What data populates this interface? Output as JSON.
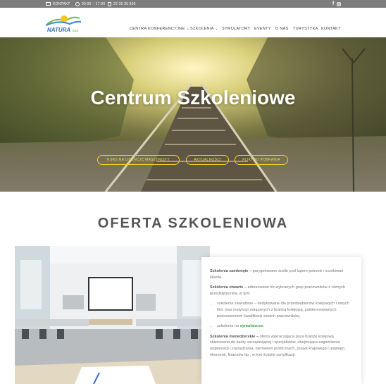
{
  "topbar": {
    "contact_label": "KONTAKT",
    "hours": "09:00 – 17:00",
    "phone": "22 39 35 600",
    "social": [
      "f",
      "ig"
    ]
  },
  "header": {
    "logo_text": "NATURA",
    "logo_sub": "tour",
    "nav": [
      "CENTRA KONFERENCYJNE ⌄",
      "SZKOLENIA ⌄",
      "SYMULATORY",
      "EVENTY",
      "O NAS",
      "TURYSTYKA",
      "KONTAKT"
    ]
  },
  "hero": {
    "title": "Centrum Szkoleniowe",
    "buttons": [
      "KURS NA LICENCJĘ MASZYNISTY",
      "AKTUALNOŚCI",
      "PLIKI DO POBRANIA"
    ]
  },
  "offer": {
    "title": "OFERTA SZKOLENIOWA",
    "closed_label": "Szkolenia zamknięte –",
    "closed_text": " przygotowane ściśle pod kątem potrzeb i oczekiwań klienta.",
    "open_label": "Szkolenia otwarte –",
    "open_text": " adresowane do wybranych grup pracowników z różnych przedsiębiorstw, w tym:",
    "bullet1": "szkolenia zawodowe – dedykowane dla przedsiębiorstw kolejowych i innych firm oraz instytucji związanych z branżą kolejową, zainteresowanych podnoszeniem kwalifikacji swoich pracowników,",
    "bullet2_pre": "szkolenia na ",
    "bullet2_link": "symulatorze.",
    "mgmt_label": "Szkolenia menedżerskie –",
    "mgmt_text": " oferta wykraczająca poza branżę kolejową skierowana do kadry zarządzającej i specjalistów, obejmująca zagadnienia organizacji i zarządzania, zamówień publicznych, prawa krajowego i unijnego, ekonomii, finansów itp., w tym ścieżki certyfikacji."
  },
  "colors": {
    "topbar": "#7d7d7d",
    "accent_yellow": "#f0d020",
    "green": "#3aa64a"
  }
}
